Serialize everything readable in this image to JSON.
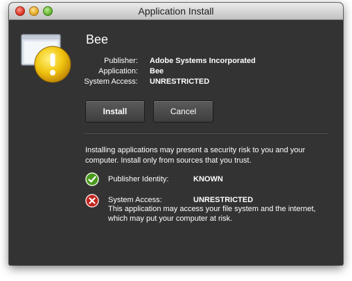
{
  "window": {
    "title": "Application Install"
  },
  "app": {
    "name": "Bee",
    "icon": "warning-app-icon",
    "details": [
      {
        "label": "Publisher:",
        "value": "Adobe Systems Incorporated"
      },
      {
        "label": "Application:",
        "value": "Bee"
      },
      {
        "label": "System Access:",
        "value": "UNRESTRICTED"
      }
    ]
  },
  "buttons": {
    "install": "Install",
    "cancel": "Cancel"
  },
  "security": {
    "warning": "Installing applications may present a security risk to you and your computer. Install only from sources that you trust.",
    "items": [
      {
        "label": "Publisher Identity:",
        "value": "KNOWN",
        "icon": "check-icon",
        "color": "#4a9a1e"
      },
      {
        "label": "System Access:",
        "value": "UNRESTRICTED",
        "icon": "error-icon",
        "color": "#c0231c",
        "description": "This application may access your file system and the internet, which may put your computer at risk."
      }
    ]
  }
}
